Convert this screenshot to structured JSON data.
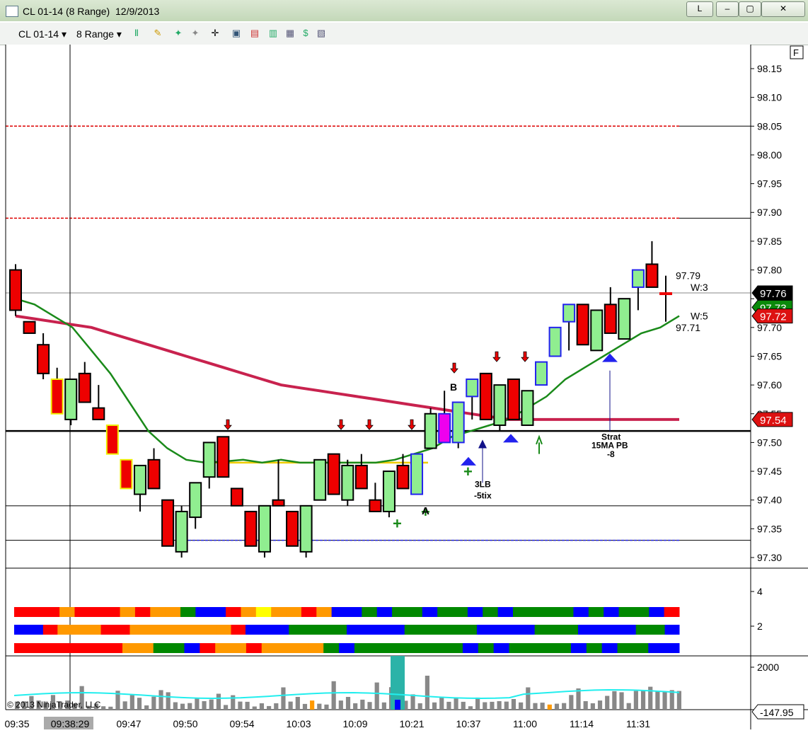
{
  "window": {
    "title": "CL 01-14 (8 Range)  12/9/2013",
    "buttons": [
      "L",
      "minimize",
      "maximize",
      "close"
    ]
  },
  "toolbar": {
    "instrument": "CL 01-14",
    "interval": "8 Range",
    "icons": [
      "bars-type-icon",
      "pencil-draw-icon",
      "add-indicator-icon",
      "strategy-icon",
      "crosshair-icon",
      "zoom-icon",
      "chart-trader-icon",
      "data-box-icon",
      "properties-icon",
      "dollar-icon",
      "template-icon"
    ]
  },
  "chart_data": {
    "type": "candlestick",
    "price_axis": {
      "ticks": [
        "98.15",
        "98.10",
        "98.05",
        "98.00",
        "97.95",
        "97.90",
        "97.85",
        "97.80",
        "97.75",
        "97.70",
        "97.65",
        "97.60",
        "97.55",
        "97.50",
        "97.45",
        "97.40",
        "97.35",
        "97.30"
      ],
      "range": [
        97.27,
        98.18
      ],
      "current_price": "97.76",
      "marker_1": "97.73",
      "marker_2": "97.72",
      "marker_3": "97.54",
      "f_button": "F"
    },
    "time_axis": {
      "labels": [
        "09:35",
        "09:38:29",
        "09:47",
        "09:50",
        "09:54",
        "10:03",
        "10:09",
        "10:21",
        "10:37",
        "11:00",
        "11:14",
        "11:31"
      ],
      "crosshair_label": "09:38:29"
    },
    "candles": [
      {
        "o": 97.8,
        "h": 97.81,
        "l": 97.72,
        "c": 97.73,
        "s": "down"
      },
      {
        "o": 97.71,
        "h": 97.71,
        "l": 97.69,
        "c": 97.69,
        "s": "down"
      },
      {
        "o": 97.67,
        "h": 97.69,
        "l": 97.61,
        "c": 97.62,
        "s": "down"
      },
      {
        "o": 97.61,
        "h": 97.63,
        "l": 97.55,
        "c": 97.55,
        "s": "down",
        "style": "yellow"
      },
      {
        "o": 97.54,
        "h": 97.61,
        "l": 97.53,
        "c": 97.61,
        "s": "up"
      },
      {
        "o": 97.62,
        "h": 97.64,
        "l": 97.57,
        "c": 97.57,
        "s": "down"
      },
      {
        "o": 97.56,
        "h": 97.6,
        "l": 97.54,
        "c": 97.54,
        "s": "down"
      },
      {
        "o": 97.53,
        "h": 97.53,
        "l": 97.48,
        "c": 97.48,
        "s": "down",
        "style": "yellow"
      },
      {
        "o": 97.47,
        "h": 97.47,
        "l": 97.42,
        "c": 97.42,
        "s": "down",
        "style": "yellow"
      },
      {
        "o": 97.41,
        "h": 97.46,
        "l": 97.38,
        "c": 97.46,
        "s": "up"
      },
      {
        "o": 97.47,
        "h": 97.49,
        "l": 97.42,
        "c": 97.42,
        "s": "down"
      },
      {
        "o": 97.4,
        "h": 97.4,
        "l": 97.32,
        "c": 97.32,
        "s": "down"
      },
      {
        "o": 97.31,
        "h": 97.39,
        "l": 97.3,
        "c": 97.38,
        "s": "up"
      },
      {
        "o": 97.37,
        "h": 97.43,
        "l": 97.35,
        "c": 97.43,
        "s": "up"
      },
      {
        "o": 97.44,
        "h": 97.5,
        "l": 97.42,
        "c": 97.5,
        "s": "up"
      },
      {
        "o": 97.51,
        "h": 97.51,
        "l": 97.44,
        "c": 97.44,
        "s": "down"
      },
      {
        "o": 97.42,
        "h": 97.42,
        "l": 97.39,
        "c": 97.39,
        "s": "down"
      },
      {
        "o": 97.38,
        "h": 97.38,
        "l": 97.32,
        "c": 97.32,
        "s": "down"
      },
      {
        "o": 97.31,
        "h": 97.39,
        "l": 97.3,
        "c": 97.39,
        "s": "up"
      },
      {
        "o": 97.4,
        "h": 97.47,
        "l": 97.39,
        "c": 97.39,
        "s": "down"
      },
      {
        "o": 97.38,
        "h": 97.38,
        "l": 97.32,
        "c": 97.32,
        "s": "down"
      },
      {
        "o": 97.31,
        "h": 97.39,
        "l": 97.3,
        "c": 97.39,
        "s": "up"
      },
      {
        "o": 97.4,
        "h": 97.47,
        "l": 97.4,
        "c": 97.47,
        "s": "up"
      },
      {
        "o": 97.48,
        "h": 97.48,
        "l": 97.41,
        "c": 97.41,
        "s": "down"
      },
      {
        "o": 97.4,
        "h": 97.47,
        "l": 97.39,
        "c": 97.46,
        "s": "up"
      },
      {
        "o": 97.46,
        "h": 97.48,
        "l": 97.42,
        "c": 97.42,
        "s": "down"
      },
      {
        "o": 97.4,
        "h": 97.43,
        "l": 97.38,
        "c": 97.38,
        "s": "down"
      },
      {
        "o": 97.38,
        "h": 97.45,
        "l": 97.37,
        "c": 97.45,
        "s": "up"
      },
      {
        "o": 97.46,
        "h": 97.48,
        "l": 97.46,
        "c": 97.42,
        "s": "down"
      },
      {
        "o": 97.41,
        "h": 97.48,
        "l": 97.41,
        "c": 97.48,
        "s": "up",
        "style": "blue"
      },
      {
        "o": 97.49,
        "h": 97.56,
        "l": 97.49,
        "c": 97.55,
        "s": "up"
      },
      {
        "o": 97.55,
        "h": 97.59,
        "l": 97.5,
        "c": 97.5,
        "s": "down",
        "style": "magenta"
      },
      {
        "o": 97.5,
        "h": 97.57,
        "l": 97.49,
        "c": 97.57,
        "s": "up",
        "style": "blue"
      },
      {
        "o": 97.58,
        "h": 97.61,
        "l": 97.54,
        "c": 97.61,
        "s": "up",
        "style": "blue"
      },
      {
        "o": 97.62,
        "h": 97.62,
        "l": 97.54,
        "c": 97.54,
        "s": "down"
      },
      {
        "o": 97.53,
        "h": 97.6,
        "l": 97.52,
        "c": 97.6,
        "s": "up"
      },
      {
        "o": 97.61,
        "h": 97.61,
        "l": 97.54,
        "c": 97.54,
        "s": "down"
      },
      {
        "o": 97.53,
        "h": 97.59,
        "l": 97.53,
        "c": 97.59,
        "s": "up"
      },
      {
        "o": 97.6,
        "h": 97.64,
        "l": 97.6,
        "c": 97.64,
        "s": "up",
        "style": "blue"
      },
      {
        "o": 97.65,
        "h": 97.7,
        "l": 97.65,
        "c": 97.7,
        "s": "up",
        "style": "blue"
      },
      {
        "o": 97.71,
        "h": 97.74,
        "l": 97.66,
        "c": 97.74,
        "s": "up",
        "style": "blue"
      },
      {
        "o": 97.74,
        "h": 97.74,
        "l": 97.67,
        "c": 97.67,
        "s": "down"
      },
      {
        "o": 97.66,
        "h": 97.73,
        "l": 97.66,
        "c": 97.73,
        "s": "up"
      },
      {
        "o": 97.74,
        "h": 97.77,
        "l": 97.69,
        "c": 97.69,
        "s": "down"
      },
      {
        "o": 97.68,
        "h": 97.75,
        "l": 97.68,
        "c": 97.75,
        "s": "up"
      },
      {
        "o": 97.77,
        "h": 97.8,
        "l": 97.73,
        "c": 97.8,
        "s": "up",
        "style": "blue"
      },
      {
        "o": 97.81,
        "h": 97.85,
        "l": 97.77,
        "c": 97.77,
        "s": "down"
      },
      {
        "o": 97.76,
        "h": 97.79,
        "l": 97.71,
        "c": 97.76,
        "s": "forming"
      }
    ],
    "levels": {
      "red_dashed_top": 98.05,
      "red_dashed_2": 97.89,
      "black_solid": 97.52,
      "blue_dashed": 97.33,
      "gray_line_1": 97.76,
      "gray_line_2": 97.39,
      "gray_line_3": 97.33,
      "yellow_line": 97.465
    },
    "annotations": {
      "a_label": "A",
      "b_label": "B",
      "three_lb": "3LB",
      "minus5tix": "-5tix",
      "strat": "Strat",
      "ma_pb": "15MA PB",
      "minus8": "-8",
      "hi_price": "97.79",
      "w3": "W:3",
      "w5": "W:5",
      "lo_price": "97.71"
    },
    "indicator_panel": {
      "ticks": [
        "4",
        "2"
      ],
      "rows": [
        [
          "red",
          "red",
          "red",
          "orange",
          "red",
          "red",
          "red",
          "orange",
          "red",
          "orange",
          "orange",
          "green",
          "blue",
          "blue",
          "red",
          "orange",
          "yellow",
          "orange",
          "orange",
          "red",
          "orange",
          "blue",
          "blue",
          "green",
          "blue",
          "green",
          "green",
          "blue",
          "green",
          "green",
          "blue",
          "green",
          "blue",
          "green",
          "green",
          "green",
          "green",
          "blue",
          "green",
          "blue",
          "green",
          "green",
          "blue",
          "red"
        ],
        [
          "blue",
          "blue",
          "red",
          "orange",
          "orange",
          "orange",
          "red",
          "red",
          "orange",
          "orange",
          "orange",
          "orange",
          "orange",
          "orange",
          "orange",
          "red",
          "blue",
          "blue",
          "blue",
          "green",
          "green",
          "green",
          "green",
          "blue",
          "blue",
          "blue",
          "blue",
          "green",
          "green",
          "green",
          "green",
          "green",
          "blue",
          "blue",
          "blue",
          "blue",
          "green",
          "green",
          "green",
          "blue",
          "blue",
          "blue",
          "blue",
          "green",
          "green",
          "blue"
        ],
        [
          "red",
          "red",
          "red",
          "red",
          "red",
          "red",
          "red",
          "orange",
          "orange",
          "green",
          "green",
          "blue",
          "red",
          "orange",
          "orange",
          "red",
          "orange",
          "orange",
          "orange",
          "orange",
          "green",
          "blue",
          "green",
          "green",
          "green",
          "green",
          "green",
          "green",
          "green",
          "blue",
          "green",
          "blue",
          "green",
          "green",
          "green",
          "green",
          "blue",
          "green",
          "blue",
          "green",
          "green",
          "blue",
          "blue"
        ]
      ]
    },
    "volume_panel": {
      "ticks": [
        "2000"
      ],
      "last_label": "-147.95",
      "copyright": "© 2013 NinjaTrader, LLC",
      "values": [
        380,
        390,
        640,
        430,
        380,
        690,
        380,
        430,
        290,
        1110,
        180,
        290,
        160,
        140,
        890,
        390,
        720,
        560,
        200,
        610,
        920,
        820,
        350,
        280,
        310,
        550,
        400,
        480,
        750,
        220,
        680,
        380,
        370,
        150,
        300,
        170,
        300,
        1050,
        380,
        600,
        270,
        430,
        280,
        240,
        1340,
        430,
        600,
        300,
        470,
        360,
        1280,
        340,
        1060,
        450,
        420,
        720,
        300,
        1600,
        340,
        610,
        370,
        550,
        370,
        160,
        570,
        350,
        370,
        400,
        380,
        500,
        340,
        1050,
        310,
        330,
        240,
        280,
        310,
        690,
        1000,
        400,
        300,
        430,
        650,
        870,
        820,
        310,
        880,
        920,
        1080,
        860,
        860,
        920,
        880
      ],
      "highlight_bar": 27
    },
    "moving_averages": {
      "slow_ma_red": [
        97.72,
        97.715,
        97.71,
        97.705,
        97.7,
        97.69,
        97.68,
        97.67,
        97.66,
        97.65,
        97.64,
        97.63,
        97.62,
        97.61,
        97.6,
        97.595,
        97.59,
        97.585,
        97.58,
        97.575,
        97.57,
        97.565,
        97.56,
        97.555,
        97.55,
        97.545,
        97.54,
        97.54,
        97.54,
        97.54,
        97.54,
        97.54,
        97.54,
        97.54,
        97.54,
        97.54
      ],
      "fast_ma": [
        97.75,
        97.74,
        97.72,
        97.7,
        97.66,
        97.62,
        97.57,
        97.52,
        97.49,
        97.47,
        97.465,
        97.467,
        97.47,
        97.465,
        97.47,
        97.465,
        97.465,
        97.465,
        97.465,
        97.465,
        97.47,
        97.48,
        97.49,
        97.51,
        97.52,
        97.53,
        97.54,
        97.56,
        97.58,
        97.61,
        97.63,
        97.65,
        97.67,
        97.69,
        97.7,
        97.72
      ]
    }
  }
}
